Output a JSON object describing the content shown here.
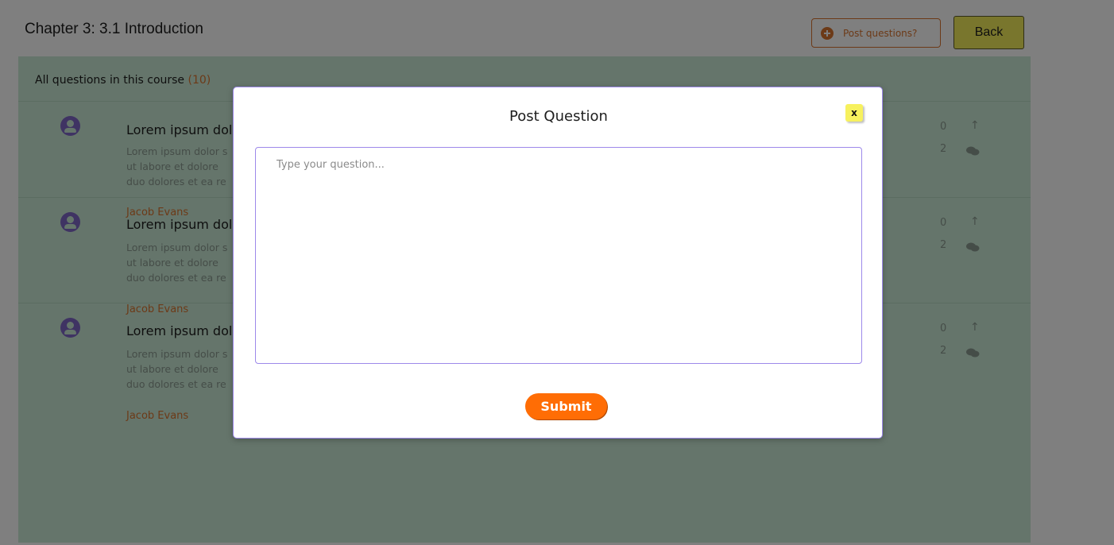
{
  "header": {
    "title": "Chapter 3: 3.1 Introduction",
    "post_button_label": "Post questions?",
    "back_button_label": "Back"
  },
  "questions_panel": {
    "heading": "All questions in this course",
    "count": "(10)",
    "items": [
      {
        "author": "",
        "title": "Lorem ipsum dolor",
        "body_lines": [
          "Lorem ipsum dolor s",
          "ut labore et dolore",
          "duo dolores et ea re"
        ],
        "upvotes": "0",
        "replies": "2"
      },
      {
        "author": "Jacob Evans",
        "title": "Lorem ipsum dolor",
        "body_lines": [
          "Lorem ipsum dolor s",
          "ut labore et dolore",
          "duo dolores et ea re"
        ],
        "upvotes": "0",
        "replies": "2"
      },
      {
        "author": "Jacob Evans",
        "title": "Lorem ipsum dolor",
        "body_lines": [
          "Lorem ipsum dolor s",
          "ut labore et dolore",
          "duo dolores et ea re"
        ],
        "upvotes": "0",
        "replies": "2"
      }
    ],
    "last_author": "Jacob Evans"
  },
  "modal": {
    "title": "Post Question",
    "close_label": "x",
    "input_placeholder": "Type your question...",
    "input_value": "",
    "submit_label": "Submit"
  },
  "colors": {
    "accent_orange": "#ff6d05",
    "back_button": "#f3ec5b",
    "panel_green": "#cbead6",
    "avatar_purple": "#7e66c6"
  }
}
